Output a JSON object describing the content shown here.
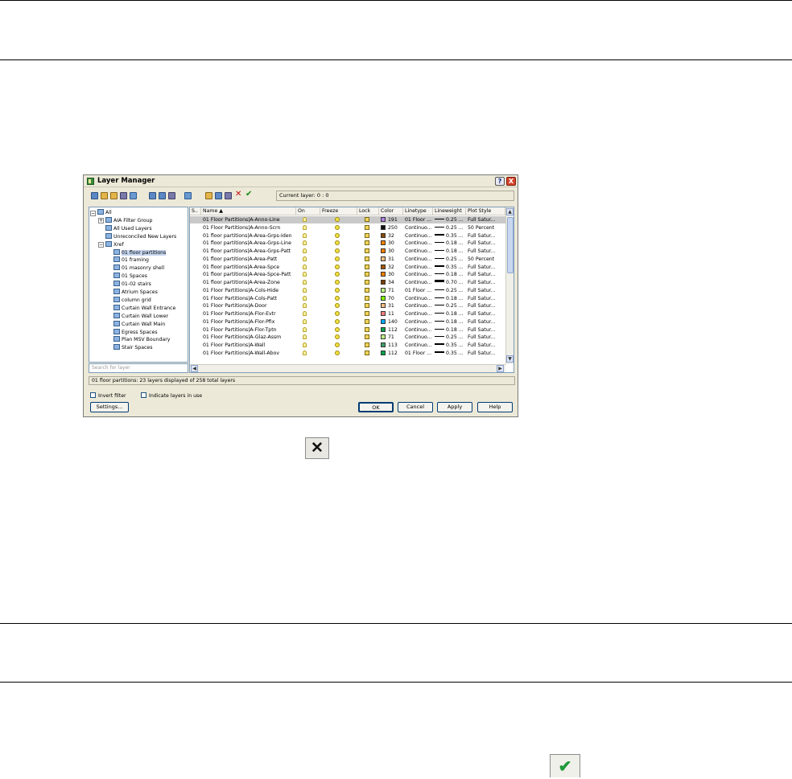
{
  "dialog": {
    "title": "Layer Manager",
    "help_btn": "?",
    "close_btn": "X",
    "current_layer": "Current layer: 0 : 0",
    "search_placeholder": "Search for layer",
    "status": "01 floor partitions: 23 layers displayed of 258 total layers",
    "invert_filter": "Invert filter",
    "indicate_layers": "Indicate layers in use",
    "settings": "Settings...",
    "ok": "OK",
    "cancel": "Cancel",
    "apply": "Apply",
    "help": "Help"
  },
  "tree": [
    {
      "label": "All",
      "icon": "layers-icon"
    },
    {
      "label": "AIA Filter Group",
      "icon": "filter-group-icon"
    },
    {
      "label": "All Used Layers",
      "icon": "filter-icon"
    },
    {
      "label": "Unreconciled New Layers",
      "icon": "filter-icon"
    },
    {
      "label": "Xref",
      "icon": "xref-icon"
    },
    {
      "label": "01 floor partitions",
      "icon": "xref-file-icon"
    },
    {
      "label": "01 framing",
      "icon": "xref-file-icon"
    },
    {
      "label": "01 masonry shell",
      "icon": "xref-file-icon"
    },
    {
      "label": "01 Spaces",
      "icon": "xref-file-icon"
    },
    {
      "label": "01-02 stairs",
      "icon": "xref-file-icon"
    },
    {
      "label": "Atrium Spaces",
      "icon": "xref-file-icon"
    },
    {
      "label": "column grid",
      "icon": "xref-file-icon"
    },
    {
      "label": "Curtain Wall Entrance",
      "icon": "xref-file-icon"
    },
    {
      "label": "Curtain Wall Lower",
      "icon": "xref-file-icon"
    },
    {
      "label": "Curtain Wall Main",
      "icon": "xref-file-icon"
    },
    {
      "label": "Egress Spaces",
      "icon": "xref-file-icon"
    },
    {
      "label": "Plan MSV Boundary",
      "icon": "xref-file-icon"
    },
    {
      "label": "Stair Spaces",
      "icon": "xref-file-icon"
    }
  ],
  "columns": [
    "S..",
    "Name",
    "On",
    "Freeze",
    "Lock",
    "Color",
    "Linetype",
    "Lineweight",
    "Plot Style"
  ],
  "rows": [
    {
      "name": "01 Floor Partitions|A-Anno-Line",
      "color": "191",
      "hex": "#b27fe8",
      "linetype": "01 Floor ...",
      "lw": "0.25 ...",
      "plot": "Full Satur..."
    },
    {
      "name": "01 Floor Partitions|A-Anno-Scrn",
      "color": "250",
      "hex": "#111111",
      "linetype": "Continuo...",
      "lw": "0.25 ...",
      "plot": "50 Percent"
    },
    {
      "name": "01 floor partitions|A-Area-Grps-Iden",
      "color": "32",
      "hex": "#8a4a00",
      "linetype": "Continuo...",
      "lw": "0.35 ...",
      "plot": "Full Satur..."
    },
    {
      "name": "01 floor partitions|A-Area-Grps-Line",
      "color": "30",
      "hex": "#ff7f00",
      "linetype": "Continuo...",
      "lw": "0.18 ...",
      "plot": "Full Satur..."
    },
    {
      "name": "01 floor partitions|A-Area-Grps-Patt",
      "color": "30",
      "hex": "#ff7f00",
      "linetype": "Continuo...",
      "lw": "0.18 ...",
      "plot": "Full Satur..."
    },
    {
      "name": "01 floor partitions|A-Area-Patt",
      "color": "31",
      "hex": "#ffbf7f",
      "linetype": "Continuo...",
      "lw": "0.25 ...",
      "plot": "50 Percent"
    },
    {
      "name": "01 floor partitions|A-Area-Spce",
      "color": "32",
      "hex": "#a55400",
      "linetype": "Continuo...",
      "lw": "0.35 ...",
      "plot": "Full Satur..."
    },
    {
      "name": "01 floor partitions|A-Area-Spce-Patt",
      "color": "30",
      "hex": "#ff7f00",
      "linetype": "Continuo...",
      "lw": "0.18 ...",
      "plot": "Full Satur..."
    },
    {
      "name": "01 floor partitions|A-Area-Zone",
      "color": "34",
      "hex": "#7f3f00",
      "linetype": "Continuo...",
      "lw": "0.70 ...",
      "plot": "Full Satur..."
    },
    {
      "name": "01 Floor Partitions|A-Cols-Hide",
      "color": "71",
      "hex": "#bfff7f",
      "linetype": "01 Floor ...",
      "lw": "0.25 ...",
      "plot": "Full Satur..."
    },
    {
      "name": "01 Floor Partitions|A-Cols-Patt",
      "color": "70",
      "hex": "#7fff00",
      "linetype": "Continuo...",
      "lw": "0.18 ...",
      "plot": "Full Satur..."
    },
    {
      "name": "01 Floor Partitions|A-Door",
      "color": "31",
      "hex": "#ffbf7f",
      "linetype": "Continuo...",
      "lw": "0.25 ...",
      "plot": "Full Satur..."
    },
    {
      "name": "01 Floor Partitions|A-Flor-Evtr",
      "color": "11",
      "hex": "#ff7f7f",
      "linetype": "Continuo...",
      "lw": "0.18 ...",
      "plot": "Full Satur..."
    },
    {
      "name": "01 Floor Partitions|A-Flor-Pfix",
      "color": "140",
      "hex": "#00aaff",
      "linetype": "Continuo...",
      "lw": "0.18 ...",
      "plot": "Full Satur..."
    },
    {
      "name": "01 Floor Partitions|A-Flor-Tptn",
      "color": "112",
      "hex": "#00a54a",
      "linetype": "Continuo...",
      "lw": "0.18 ...",
      "plot": "Full Satur..."
    },
    {
      "name": "01 Floor Partitions|A-Glaz-Assm",
      "color": "71",
      "hex": "#bfff7f",
      "linetype": "Continuo...",
      "lw": "0.25 ...",
      "plot": "Full Satur..."
    },
    {
      "name": "01 Floor Partitions|A-Wall",
      "color": "113",
      "hex": "#3f9f6a",
      "linetype": "Continuo...",
      "lw": "0.35 ...",
      "plot": "Full Satur..."
    },
    {
      "name": "01 Floor Partitions|A-Wall-Abov",
      "color": "112",
      "hex": "#00a54a",
      "linetype": "01 Floor ...",
      "lw": "0.35 ...",
      "plot": "Full Satur..."
    }
  ],
  "floating": {
    "delete_icon": "close-x-icon",
    "delete_glyph": "✕",
    "check_icon": "checkmark-icon",
    "check_glyph": "✔"
  }
}
